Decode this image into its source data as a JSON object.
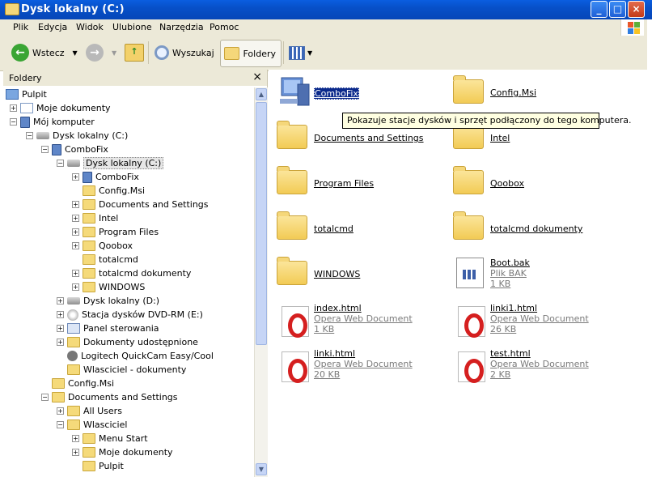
{
  "window": {
    "title": "Dysk lokalny (C:)"
  },
  "menu": [
    "Plik",
    "Edycja",
    "Widok",
    "Ulubione",
    "Narzędzia",
    "Pomoc"
  ],
  "toolbar": {
    "back": "Wstecz",
    "search": "Wyszukaj",
    "folders": "Foldery"
  },
  "folders_pane": {
    "title": "Foldery",
    "close": "×"
  },
  "tree": [
    {
      "label": "Pulpit",
      "icon": "desktop-icon"
    },
    {
      "label": "Moje dokumenty",
      "icon": "documents-icon"
    },
    {
      "label": "Mój komputer",
      "icon": "computer-icon"
    },
    {
      "label": "Dysk lokalny (C:)",
      "icon": "drive-icon"
    },
    {
      "label": "ComboFix",
      "icon": "computer-icon"
    },
    {
      "label": "Dysk lokalny (C:)",
      "icon": "drive-icon"
    },
    {
      "label": "ComboFix",
      "icon": "computer-icon"
    },
    {
      "label": "Config.Msi",
      "icon": "folder-icon"
    },
    {
      "label": "Documents and Settings",
      "icon": "folder-icon"
    },
    {
      "label": "Intel",
      "icon": "folder-icon"
    },
    {
      "label": "Program Files",
      "icon": "folder-icon"
    },
    {
      "label": "Qoobox",
      "icon": "folder-icon"
    },
    {
      "label": "totalcmd",
      "icon": "folder-icon"
    },
    {
      "label": "totalcmd dokumenty",
      "icon": "folder-icon"
    },
    {
      "label": "WINDOWS",
      "icon": "folder-icon"
    },
    {
      "label": "Dysk lokalny (D:)",
      "icon": "drive-icon"
    },
    {
      "label": "Stacja dysków DVD-RM (E:)",
      "icon": "cdrom-icon"
    },
    {
      "label": "Panel sterowania",
      "icon": "control-panel-icon"
    },
    {
      "label": "Dokumenty udostępnione",
      "icon": "folder-icon"
    },
    {
      "label": "Logitech QuickCam Easy/Cool",
      "icon": "camera-icon"
    },
    {
      "label": "Wlasciciel - dokumenty",
      "icon": "folder-icon"
    },
    {
      "label": "Config.Msi",
      "icon": "folder-icon"
    },
    {
      "label": "Documents and Settings",
      "icon": "folder-icon"
    },
    {
      "label": "All Users",
      "icon": "folder-icon"
    },
    {
      "label": "Wlasciciel",
      "icon": "folder-icon"
    },
    {
      "label": "Menu Start",
      "icon": "folder-icon"
    },
    {
      "label": "Moje dokumenty",
      "icon": "folder-icon"
    },
    {
      "label": "Pulpit",
      "icon": "folder-icon"
    }
  ],
  "files": [
    {
      "name": "ComboFix",
      "icon": "computer-icon"
    },
    {
      "name": "Config.Msi",
      "icon": "folder-icon"
    },
    {
      "name": "Documents and Settings",
      "icon": "folder-icon"
    },
    {
      "name": "Intel",
      "icon": "folder-icon"
    },
    {
      "name": "Program Files",
      "icon": "folder-icon"
    },
    {
      "name": "Qoobox",
      "icon": "folder-icon"
    },
    {
      "name": "totalcmd",
      "icon": "folder-icon"
    },
    {
      "name": "totalcmd dokumenty",
      "icon": "folder-icon"
    },
    {
      "name": "WINDOWS",
      "icon": "folder-icon"
    },
    {
      "name": "Boot.bak",
      "type": "Plik BAK",
      "size": "1 KB",
      "icon": "bak-file-icon"
    },
    {
      "name": "index.html",
      "type": "Opera Web Document",
      "size": "1 KB",
      "icon": "opera-icon"
    },
    {
      "name": "linki1.html",
      "type": "Opera Web Document",
      "size": "26 KB",
      "icon": "opera-icon"
    },
    {
      "name": "linki.html",
      "type": "Opera Web Document",
      "size": "20 KB",
      "icon": "opera-icon"
    },
    {
      "name": "test.html",
      "type": "Opera Web Document",
      "size": "2 KB",
      "icon": "opera-icon"
    }
  ],
  "tooltip": "Pokazuje stacje dysków i sprzęt podłączony do tego komputera."
}
